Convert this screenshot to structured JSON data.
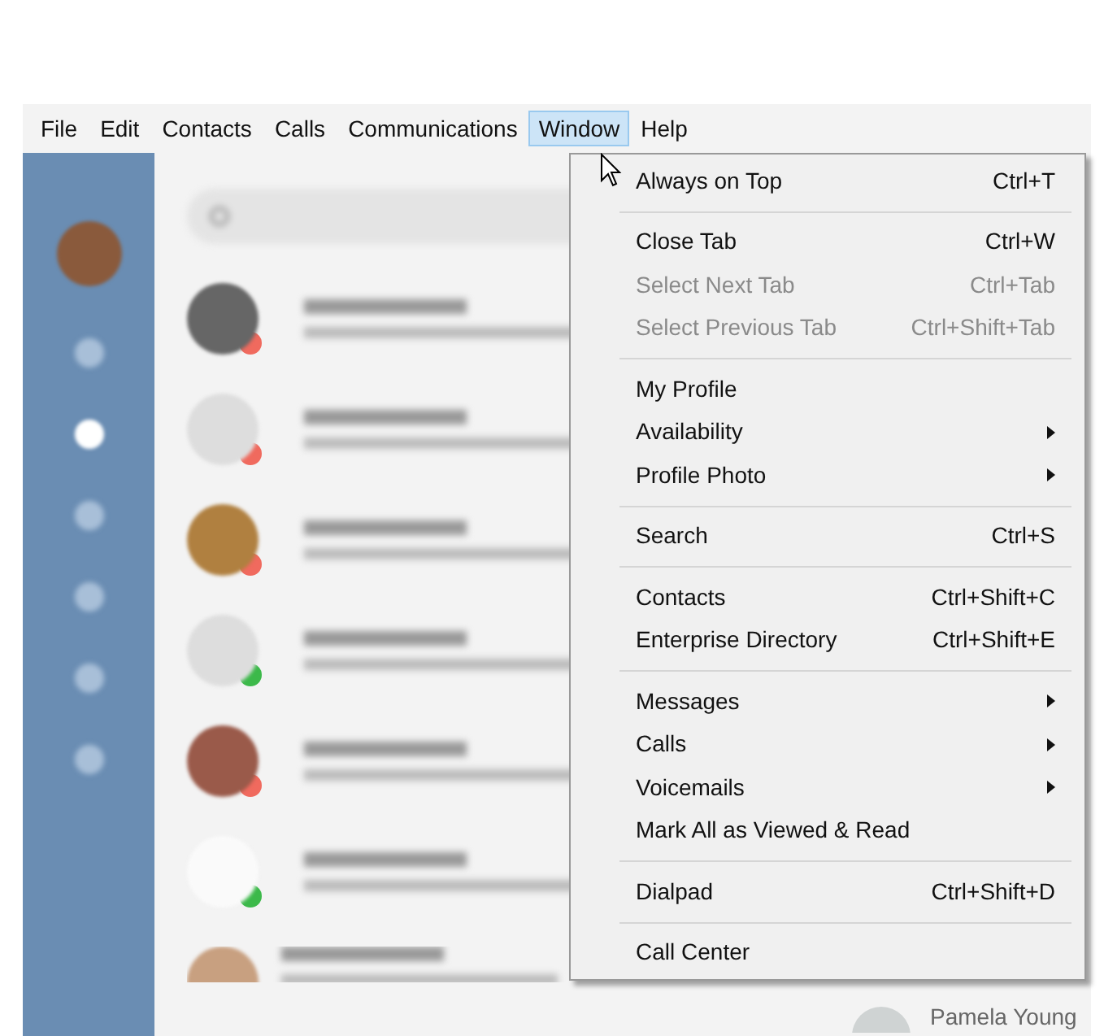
{
  "menu_bar": [
    {
      "label": "File",
      "selected": false
    },
    {
      "label": "Edit",
      "selected": false
    },
    {
      "label": "Contacts",
      "selected": false
    },
    {
      "label": "Calls",
      "selected": false
    },
    {
      "label": "Communications",
      "selected": false
    },
    {
      "label": "Window",
      "selected": true
    },
    {
      "label": "Help",
      "selected": false
    }
  ],
  "window_menu": [
    {
      "kind": "item",
      "label": "Always on Top",
      "shortcut": "Ctrl+T",
      "disabled": false,
      "submenu": false
    },
    {
      "kind": "separator"
    },
    {
      "kind": "item",
      "label": "Close Tab",
      "shortcut": "Ctrl+W",
      "disabled": false,
      "submenu": false
    },
    {
      "kind": "item",
      "label": "Select Next Tab",
      "shortcut": "Ctrl+Tab",
      "disabled": true,
      "submenu": false
    },
    {
      "kind": "item",
      "label": "Select Previous Tab",
      "shortcut": "Ctrl+Shift+Tab",
      "disabled": true,
      "submenu": false
    },
    {
      "kind": "separator"
    },
    {
      "kind": "item",
      "label": "My Profile",
      "disabled": false,
      "submenu": false
    },
    {
      "kind": "item",
      "label": "Availability",
      "disabled": false,
      "submenu": true
    },
    {
      "kind": "item",
      "label": "Profile Photo",
      "disabled": false,
      "submenu": true
    },
    {
      "kind": "separator"
    },
    {
      "kind": "item",
      "label": "Search",
      "shortcut": "Ctrl+S",
      "disabled": false,
      "submenu": false
    },
    {
      "kind": "separator"
    },
    {
      "kind": "item",
      "label": "Contacts",
      "shortcut": "Ctrl+Shift+C",
      "disabled": false,
      "submenu": false
    },
    {
      "kind": "item",
      "label": "Enterprise Directory",
      "shortcut": "Ctrl+Shift+E",
      "disabled": false,
      "submenu": false
    },
    {
      "kind": "separator"
    },
    {
      "kind": "item",
      "label": "Messages",
      "disabled": false,
      "submenu": true
    },
    {
      "kind": "item",
      "label": "Calls",
      "disabled": false,
      "submenu": true
    },
    {
      "kind": "item",
      "label": "Voicemails",
      "disabled": false,
      "submenu": true
    },
    {
      "kind": "item",
      "label": "Mark All as Viewed & Read",
      "disabled": false,
      "submenu": false
    },
    {
      "kind": "separator"
    },
    {
      "kind": "item",
      "label": "Dialpad",
      "shortcut": "Ctrl+Shift+D",
      "disabled": false,
      "submenu": false
    },
    {
      "kind": "separator"
    },
    {
      "kind": "item",
      "label": "Call Center",
      "disabled": false,
      "submenu": false
    }
  ],
  "conversations": [
    {
      "color": "#f06a5e",
      "cut_off": false
    },
    {
      "color": "#f06a5e",
      "cut_off": false
    },
    {
      "color": "#f06a5e",
      "cut_off": false
    },
    {
      "color": "#3cb94a",
      "cut_off": false
    },
    {
      "color": "#f06a5e",
      "cut_off": false
    },
    {
      "color": "#3cb94a",
      "cut_off": false
    },
    {
      "cut_off": true
    }
  ],
  "right_pane": {
    "contact_name": "Pamela Young"
  }
}
